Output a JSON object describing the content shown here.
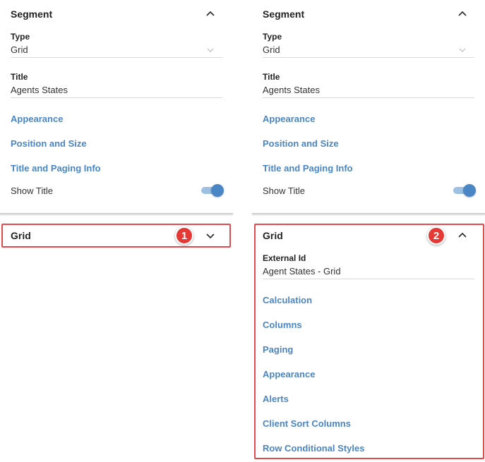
{
  "left": {
    "segment": {
      "title": "Segment",
      "type_label": "Type",
      "type_value": "Grid",
      "title_label": "Title",
      "title_value": "Agents States",
      "links": [
        "Appearance",
        "Position and Size",
        "Title and Paging Info"
      ],
      "show_title_label": "Show Title",
      "show_title_on": true
    },
    "grid": {
      "title": "Grid",
      "expanded": false,
      "badge": "1"
    }
  },
  "right": {
    "segment": {
      "title": "Segment",
      "type_label": "Type",
      "type_value": "Grid",
      "title_label": "Title",
      "title_value": "Agents States",
      "links": [
        "Appearance",
        "Position and Size",
        "Title and Paging Info"
      ],
      "show_title_label": "Show Title",
      "show_title_on": true
    },
    "grid": {
      "title": "Grid",
      "expanded": true,
      "badge": "2",
      "external_id_label": "External Id",
      "external_id_value": "Agent States - Grid",
      "links": [
        "Calculation",
        "Columns",
        "Paging",
        "Appearance",
        "Alerts",
        "Client Sort Columns",
        "Row Conditional Styles"
      ]
    }
  },
  "colors": {
    "link": "#4a86c5",
    "highlight": "#e04a4a",
    "badge": "#e53935",
    "toggle": "#4a86c5"
  },
  "icons": {
    "collapse": "chevron-up-icon",
    "expand": "chevron-down-icon",
    "select": "chevron-down-icon"
  }
}
